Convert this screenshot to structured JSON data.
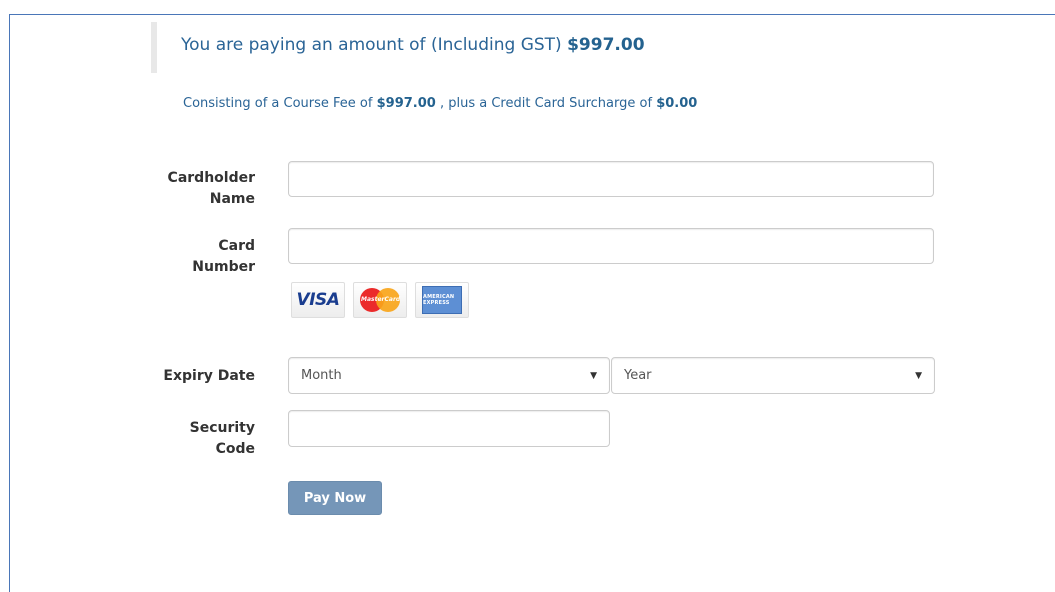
{
  "amount": {
    "prefix": "You are paying an amount of (Including GST)",
    "total": "$997.00"
  },
  "breakdown": {
    "prefix": "Consisting of a Course Fee of",
    "course_fee": "$997.00",
    "middle": ", plus a Credit Card Surcharge of",
    "surcharge": "$0.00"
  },
  "form": {
    "cardholder_label_1": "Cardholder",
    "cardholder_label_2": "Name",
    "cardholder_value": "",
    "card_number_label_1": "Card",
    "card_number_label_2": "Number",
    "card_number_value": "",
    "card_logos": {
      "visa": "VISA",
      "mastercard": "MasterCard",
      "amex": "AMERICAN EXPRESS"
    },
    "expiry_label": "Expiry Date",
    "month_selected": "Month",
    "year_selected": "Year",
    "security_label_1": "Security",
    "security_label_2": "Code",
    "security_value": "",
    "submit_label": "Pay Now"
  },
  "colors": {
    "accent_text": "#2a6496",
    "button": "#7596b8",
    "frame_border": "#4a76b8"
  }
}
